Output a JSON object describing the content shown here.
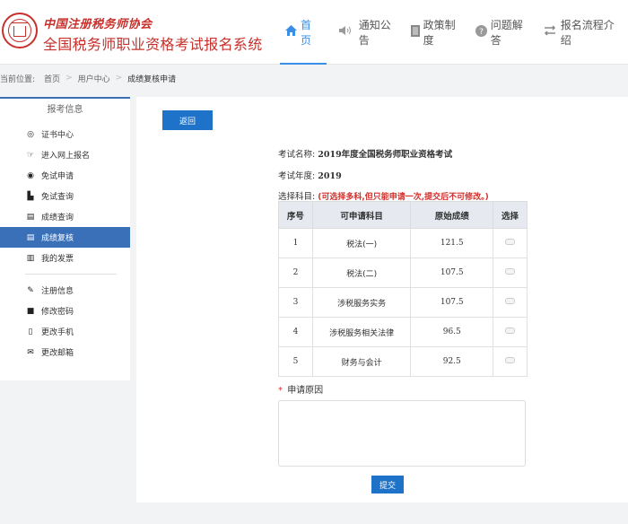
{
  "header": {
    "org_name": "中国注册税务师协会",
    "system_name": "全国税务师职业资格考试报名系统",
    "nav": [
      {
        "label": "首页",
        "icon": "home-icon",
        "active": true
      },
      {
        "label": "通知公告",
        "icon": "speaker-icon",
        "active": false
      },
      {
        "label": "政策制度",
        "icon": "document-icon",
        "active": false
      },
      {
        "label": "问题解答",
        "icon": "question-icon",
        "active": false
      },
      {
        "label": "报名流程介绍",
        "icon": "flow-icon",
        "active": false
      }
    ]
  },
  "breadcrumb": {
    "prefix": "当前位置:",
    "items": [
      "首页",
      "用户中心"
    ],
    "current": "成绩复核申请"
  },
  "sidebar": {
    "title": "报考信息",
    "group1": [
      {
        "label": "证书中心",
        "icon": "certificate-icon"
      },
      {
        "label": "进入网上报名",
        "icon": "pointer-icon"
      },
      {
        "label": "免试申请",
        "icon": "exempt-icon"
      },
      {
        "label": "免试查询",
        "icon": "search-doc-icon"
      },
      {
        "label": "成绩查询",
        "icon": "list-icon"
      },
      {
        "label": "成绩复核",
        "icon": "review-icon",
        "active": true
      },
      {
        "label": "我的发票",
        "icon": "barcode-icon"
      }
    ],
    "group2": [
      {
        "label": "注册信息",
        "icon": "wrench-icon"
      },
      {
        "label": "修改密码",
        "icon": "lock-icon"
      },
      {
        "label": "更改手机",
        "icon": "phone-icon"
      },
      {
        "label": "更改邮箱",
        "icon": "mail-icon"
      }
    ]
  },
  "main": {
    "back_label": "返回",
    "exam_name_label": "考试名称:",
    "exam_name": "2019年度全国税务师职业资格考试",
    "exam_year_label": "考试年度:",
    "exam_year": "2019",
    "subjects_label": "选择科目:",
    "subjects_note": "(可选择多科,但只能申请一次,提交后不可修改。)",
    "table": {
      "headers": [
        "序号",
        "可申请科目",
        "原始成绩",
        "选择"
      ],
      "rows": [
        {
          "no": "1",
          "subject": "税法(一)",
          "score": "121.5"
        },
        {
          "no": "2",
          "subject": "税法(二)",
          "score": "107.5"
        },
        {
          "no": "3",
          "subject": "涉税服务实务",
          "score": "107.5"
        },
        {
          "no": "4",
          "subject": "涉税服务相关法律",
          "score": "96.5"
        },
        {
          "no": "5",
          "subject": "财务与会计",
          "score": "92.5"
        }
      ]
    },
    "reason_required": "*",
    "reason_label": "申请原因",
    "reason_value": "",
    "submit_label": "提交"
  },
  "colors": {
    "brand_red": "#c8302b",
    "accent_blue": "#3a8ee6",
    "button_blue": "#1e73c8",
    "sidebar_active": "#3a70b8",
    "warning_red": "#d0312d"
  }
}
